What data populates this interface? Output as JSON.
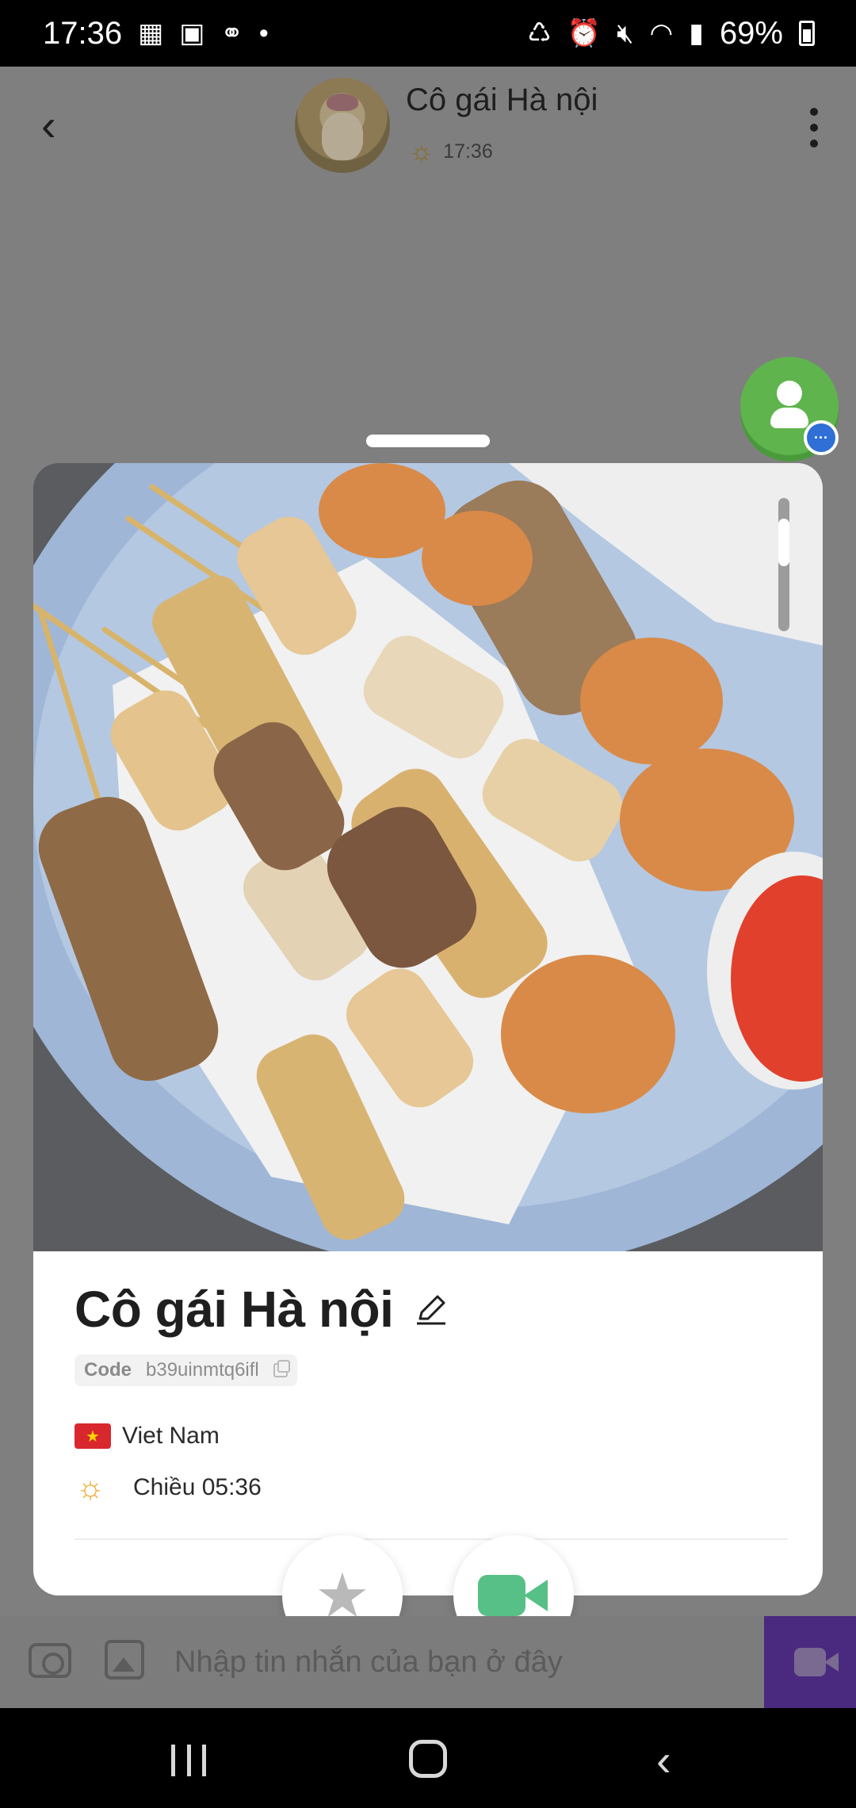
{
  "status_bar": {
    "time": "17:36",
    "battery": "69%"
  },
  "chat_header": {
    "name": "Cô gái Hà nội",
    "time": "17:36"
  },
  "profile": {
    "name": "Cô gái Hà nội",
    "code_label": "Code",
    "code_value": "b39uinmtq6ifl",
    "country": "Viet Nam",
    "local_time": "Chiều 05:36"
  },
  "input_bar": {
    "placeholder": "Nhập tin nhắn của bạn ở đây"
  },
  "colors": {
    "profile_fab": "#5fb44d",
    "call_icon": "#57c086",
    "video_button": "#4a2a7e",
    "sun": "#f1a62b"
  },
  "icons": {
    "back": "back-arrow-icon",
    "more": "more-vertical-icon",
    "edit": "pencil-icon",
    "favorite": "star-icon",
    "call": "video-camera-icon"
  }
}
